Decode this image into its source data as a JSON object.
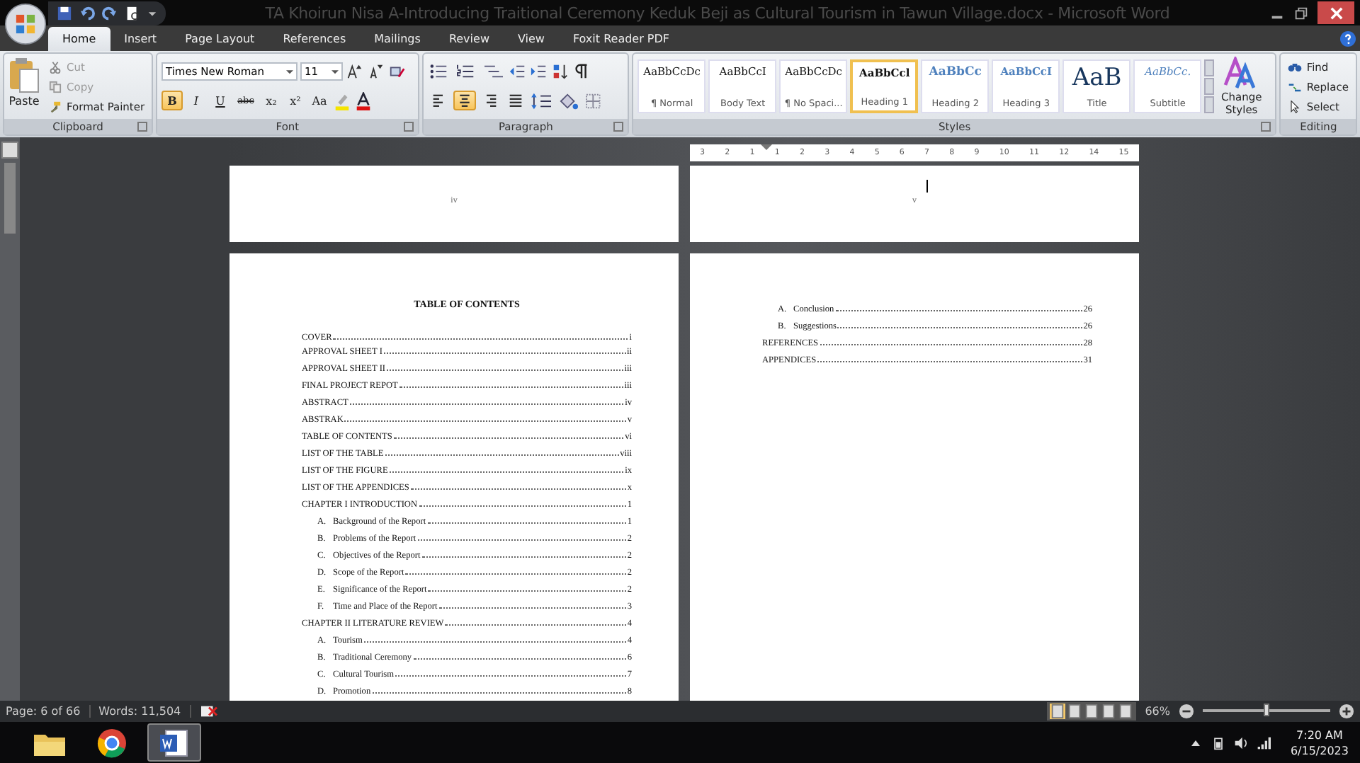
{
  "window": {
    "title": "TA Khoirun Nisa A-Introducing Traitional Ceremony Keduk Beji as Cultural Tourism in Tawun Village.docx - Microsoft Word"
  },
  "tabs": [
    {
      "label": "Home",
      "selected": true
    },
    {
      "label": "Insert",
      "selected": false
    },
    {
      "label": "Page Layout",
      "selected": false
    },
    {
      "label": "References",
      "selected": false
    },
    {
      "label": "Mailings",
      "selected": false
    },
    {
      "label": "Review",
      "selected": false
    },
    {
      "label": "View",
      "selected": false
    },
    {
      "label": "Foxit Reader PDF",
      "selected": false
    }
  ],
  "clipboard": {
    "label": "Clipboard",
    "paste": "Paste",
    "items": [
      {
        "kind": "cut",
        "label": "Cut",
        "disabled": true
      },
      {
        "kind": "copy",
        "label": "Copy",
        "disabled": true
      },
      {
        "kind": "painter",
        "label": "Format Painter",
        "disabled": false
      }
    ]
  },
  "font": {
    "label": "Font",
    "font_name": "Times New Roman",
    "font_size": "11",
    "format": [
      {
        "glyph": "B",
        "kind": "bold",
        "on": true
      },
      {
        "glyph": "I",
        "kind": "italic",
        "on": false
      },
      {
        "glyph": "U",
        "kind": "underline",
        "on": false
      },
      {
        "glyph": "abc",
        "kind": "strike",
        "on": false
      },
      {
        "glyph": "x₂",
        "kind": "plain",
        "on": false
      },
      {
        "glyph": "x²",
        "kind": "plain",
        "on": false
      },
      {
        "glyph": "Aa",
        "kind": "plain",
        "on": false
      }
    ]
  },
  "paragraph": {
    "label": "Paragraph",
    "alignment": [
      {
        "kind": "left",
        "selected": false
      },
      {
        "kind": "center",
        "selected": true
      },
      {
        "kind": "right",
        "selected": false
      },
      {
        "kind": "justify",
        "selected": false
      }
    ]
  },
  "styles": {
    "label": "Styles",
    "items": [
      {
        "preview": "AaBbCcDc",
        "label": "¶ Normal",
        "kind": "normal",
        "selected": false
      },
      {
        "preview": "AaBbCcI",
        "label": "Body Text",
        "kind": "normal",
        "selected": false
      },
      {
        "preview": "AaBbCcDc",
        "label": "¶ No Spaci...",
        "kind": "normal",
        "selected": false
      },
      {
        "preview": "AaBbCcl",
        "label": "Heading 1",
        "kind": "heading1",
        "selected": true
      },
      {
        "preview": "AaBbCc",
        "label": "Heading 2",
        "kind": "heading2",
        "selected": false
      },
      {
        "preview": "AaBbCcI",
        "label": "Heading 3",
        "kind": "heading3",
        "selected": false
      },
      {
        "preview": "AaB",
        "label": "Title",
        "kind": "title",
        "selected": false
      },
      {
        "preview": "AaBbCc.",
        "label": "Subtitle",
        "kind": "subtitle",
        "selected": false
      }
    ],
    "change": "Change Styles"
  },
  "editing": {
    "label": "Editing",
    "items": [
      {
        "kind": "find",
        "label": "Find"
      },
      {
        "kind": "replace",
        "label": "Replace"
      },
      {
        "kind": "select",
        "label": "Select"
      }
    ]
  },
  "ruler": {
    "numbers": [
      "3",
      "2",
      "1",
      "1",
      "2",
      "3",
      "4",
      "5",
      "6",
      "7",
      "8",
      "9",
      "10",
      "11",
      "12",
      "14",
      "15"
    ]
  },
  "top_pages": [
    {
      "page_number": "iv"
    },
    {
      "page_number": "v"
    }
  ],
  "left_page": {
    "title": "TABLE OF CONTENTS",
    "entries": [
      {
        "label": "COVER",
        "page": "i"
      },
      {
        "label": "APPROVAL SHEET I",
        "page": "ii"
      },
      {
        "label": "APPROVAL SHEET II",
        "page": "iii"
      },
      {
        "label": "FINAL PROJECT REPOT",
        "page": "iii"
      },
      {
        "label": "ABSTRACT",
        "page": "iv"
      },
      {
        "label": "ABSTRAK",
        "page": "v"
      },
      {
        "label": "TABLE OF CONTENTS",
        "page": "vi"
      },
      {
        "label": "LIST OF THE TABLE",
        "page": "viii"
      },
      {
        "label": "LIST OF THE FIGURE",
        "page": "ix"
      },
      {
        "label": "LIST OF THE APPENDICES",
        "page": "x"
      },
      {
        "label": "CHAPTER I INTRODUCTION",
        "page": "1",
        "children": [
          {
            "marker": "A.",
            "label": "Background of the Report",
            "page": "1"
          },
          {
            "marker": "B.",
            "label": "Problems of the Report",
            "page": "2"
          },
          {
            "marker": "C.",
            "label": "Objectives of the Report",
            "page": "2"
          },
          {
            "marker": "D.",
            "label": "Scope of the Report",
            "page": "2"
          },
          {
            "marker": "E.",
            "label": "Significance of the Report",
            "page": "2"
          },
          {
            "marker": "F.",
            "label": "Time and Place of the Report",
            "page": "3"
          }
        ]
      },
      {
        "label": "CHAPTER II LITERATURE REVIEW",
        "page": "4",
        "children": [
          {
            "marker": "A.",
            "label": "Tourism",
            "page": "4"
          },
          {
            "marker": "B.",
            "label": "Traditional Ceremony",
            "page": "6"
          },
          {
            "marker": "C.",
            "label": "Cultural Tourism",
            "page": "7"
          },
          {
            "marker": "D.",
            "label": "Promotion",
            "page": "8"
          }
        ]
      }
    ]
  },
  "right_page": {
    "children": [
      {
        "marker": "A.",
        "label": "Conclusion",
        "page": "26"
      },
      {
        "marker": "B.",
        "label": "Suggestions",
        "page": "26"
      }
    ],
    "entries": [
      {
        "label": "REFERENCES",
        "page": "28"
      },
      {
        "label": "APPENDICES",
        "page": "31"
      }
    ]
  },
  "status_bar": {
    "page": "Page: 6 of 66",
    "words": "Words: 11,504",
    "zoom": "66%",
    "zoom_level": {
      "level": 0.5
    }
  },
  "taskbar": {
    "apps": [
      {
        "kind": "folder",
        "selected": false
      },
      {
        "kind": "browser",
        "selected": false
      },
      {
        "kind": "word",
        "selected": true
      }
    ],
    "time": "7:20 AM",
    "date": "6/15/2023"
  }
}
